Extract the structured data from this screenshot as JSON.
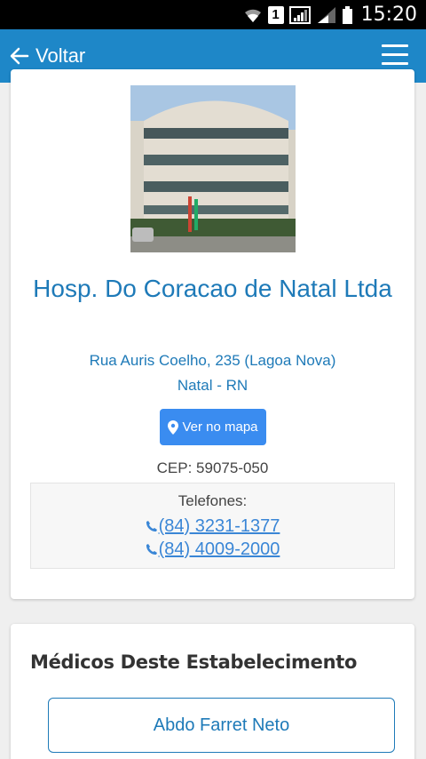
{
  "status_bar": {
    "time": "15:20",
    "sim_label": "1",
    "icons": [
      "wifi-icon",
      "sim-icon",
      "signal-icon",
      "signal-icon",
      "battery-icon"
    ]
  },
  "navbar": {
    "back_label": "Voltar",
    "back_icon": "arrow-left-icon",
    "menu_icon": "hamburger-menu-icon",
    "color": "#1e87c8"
  },
  "hospital": {
    "name": "Hosp. Do Coracao de Natal Ltda",
    "street": "Rua Auris Coelho, 235 (Lagoa Nova)",
    "city": "Natal - RN",
    "map_button_label": "Ver no mapa",
    "cep": "CEP: 59075-050",
    "phones_title": "Telefones:",
    "phones": [
      "(84) 3231-1377",
      "(84) 4009-2000"
    ],
    "accent_color": "#1e7ab8",
    "button_color": "#3a8cf0"
  },
  "doctors": {
    "section_title": "Médicos Deste Estabelecimento",
    "items": [
      "Abdo Farret Neto"
    ]
  }
}
